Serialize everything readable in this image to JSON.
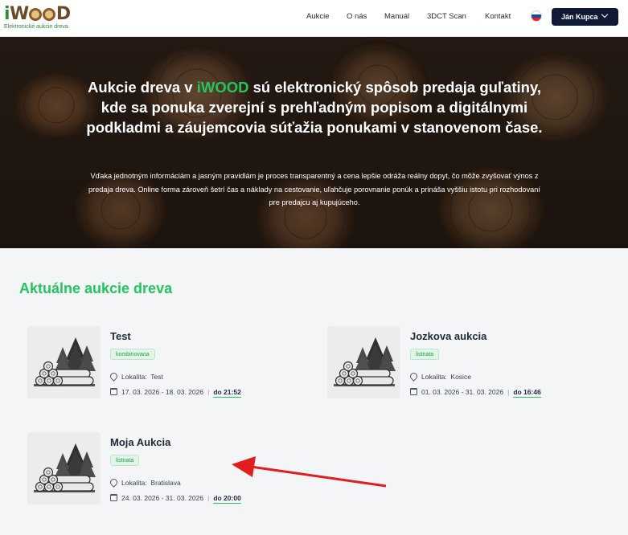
{
  "header": {
    "logo_i": "i",
    "logo_w": "W",
    "logo_d": "D",
    "logo_subtitle": "Elektronické aukcie dreva",
    "nav": [
      "Aukcie",
      "O nás",
      "Manuál",
      "3DCT Scan",
      "Kontakt"
    ],
    "language": "sk",
    "user_name": "Ján Kupca"
  },
  "hero": {
    "title_before": "Aukcie dreva v ",
    "title_accent": "iWOOD",
    "title_after": " sú elektronický spôsob predaja guľatiny, kde sa ponuka zverejní s prehľadným popisom a digitálnymi podkladmi a záujemcovia súťažia ponukami v stanovenom čase.",
    "description": "Vďaka jednotným informáciám a jasným pravidlám je proces transparentný a cena lepšie odráža reálny dopyt, čo môže zvyšovať výnos z predaja dreva. Online forma zároveň šetrí čas a náklady na cestovanie, uľahčuje porovnanie ponúk a prináša vyššiu istotu pri rozhodovaní pre predajcu aj kupujúceho."
  },
  "section": {
    "title": "Aktuálne aukcie dreva"
  },
  "auctions": [
    {
      "title": "Test",
      "type": "kombinovana",
      "location_label": "Lokalita:",
      "location": "Test",
      "dates": "17. 03. 2026 - 18. 03. 2026",
      "until": "do 21:52"
    },
    {
      "title": "Jozkova aukcia",
      "type": "listnata",
      "location_label": "Lokalita:",
      "location": "Kosice",
      "dates": "01. 03. 2026 - 31. 03. 2026",
      "until": "do 16:46"
    },
    {
      "title": "Moja Aukcia",
      "type": "listnata",
      "location_label": "Lokalita:",
      "location": "Bratislava",
      "dates": "24. 03. 2026 - 31. 03. 2026",
      "until": "do 20:00"
    }
  ],
  "colors": {
    "accent": "#22c55e",
    "header_button": "#0f1b35",
    "annotation_arrow": "#e11d1d"
  }
}
